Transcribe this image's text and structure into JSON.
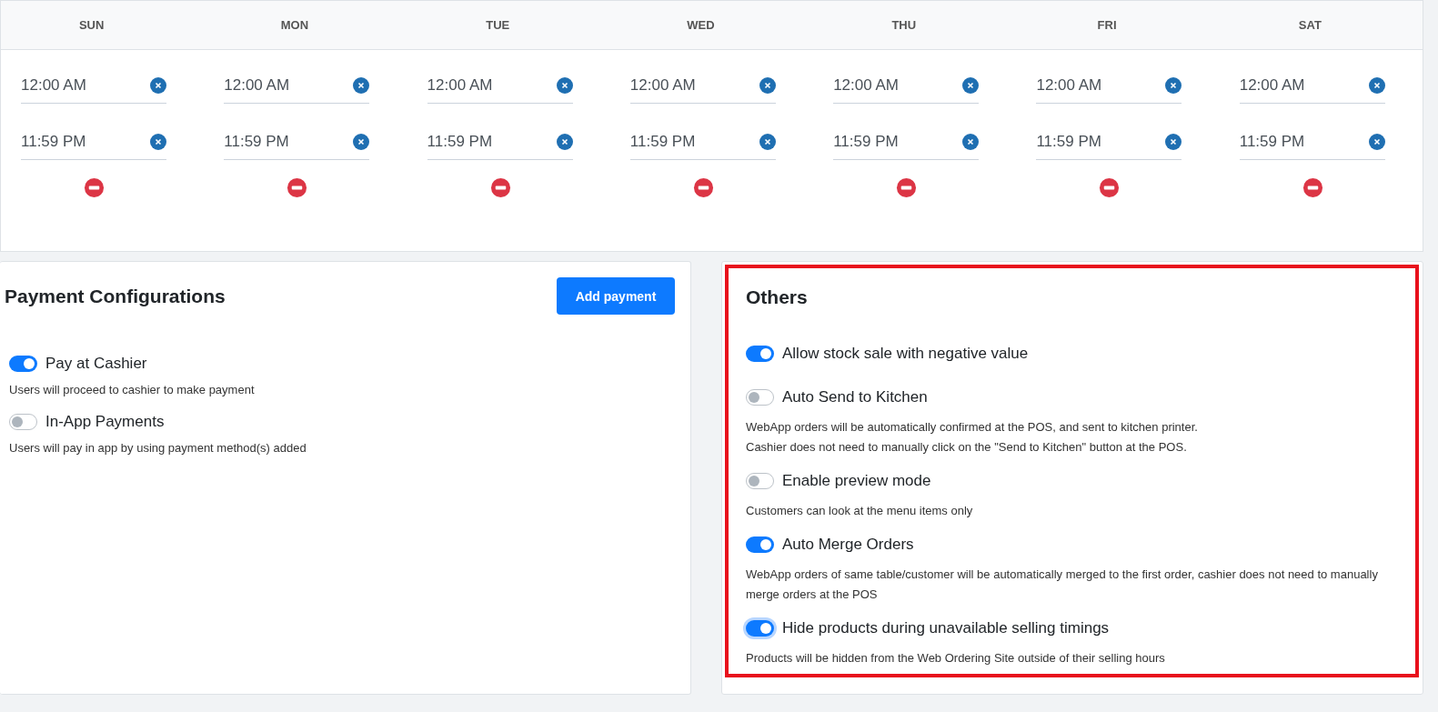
{
  "schedule": {
    "days": [
      {
        "label": "SUN",
        "start": "12:00 AM",
        "end": "11:59 PM"
      },
      {
        "label": "MON",
        "start": "12:00 AM",
        "end": "11:59 PM"
      },
      {
        "label": "TUE",
        "start": "12:00 AM",
        "end": "11:59 PM"
      },
      {
        "label": "WED",
        "start": "12:00 AM",
        "end": "11:59 PM"
      },
      {
        "label": "THU",
        "start": "12:00 AM",
        "end": "11:59 PM"
      },
      {
        "label": "FRI",
        "start": "12:00 AM",
        "end": "11:59 PM"
      },
      {
        "label": "SAT",
        "start": "12:00 AM",
        "end": "11:59 PM"
      }
    ]
  },
  "payment": {
    "title": "Payment Configurations",
    "add_button": "Add payment",
    "options": [
      {
        "label": "Pay at Cashier",
        "on": true,
        "description": [
          "Users will proceed to cashier to make payment"
        ]
      },
      {
        "label": "In-App Payments",
        "on": false,
        "description": [
          "Users will pay in app by using payment method(s) added"
        ]
      }
    ]
  },
  "others": {
    "title": "Others",
    "highlighted": true,
    "options": [
      {
        "label": "Allow stock sale with negative value",
        "on": true
      },
      {
        "label": "Auto Send to Kitchen",
        "on": false,
        "description": [
          "WebApp orders will be automatically confirmed at the POS, and sent to kitchen printer.",
          "Cashier does not need to manually click on the \"Send to Kitchen\" button at the POS."
        ]
      },
      {
        "label": "Enable preview mode",
        "on": false,
        "description": [
          "Customers can look at the menu items only"
        ]
      },
      {
        "label": "Auto Merge Orders",
        "on": true,
        "description": [
          "WebApp orders of same table/customer will be automatically merged to the first order, cashier does not need to manually merge orders at the POS"
        ]
      },
      {
        "label": "Hide products during unavailable selling timings",
        "on": true,
        "focused": true,
        "description": [
          "Products will be hidden from the Web Ordering Site outside of their selling hours"
        ]
      }
    ]
  }
}
